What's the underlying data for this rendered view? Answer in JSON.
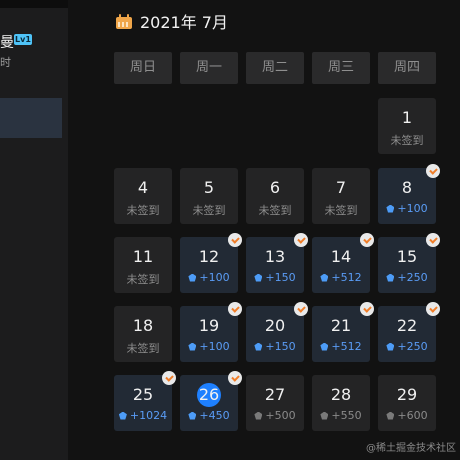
{
  "sidebar": {
    "user_name": "曼",
    "level": "Lv1",
    "user_sub": "时"
  },
  "calendar": {
    "month_title": "2021年 7月",
    "weekdays": [
      "周日",
      "周一",
      "周二",
      "周三",
      "周四"
    ],
    "unsigned_label": "未签到",
    "days": [
      {
        "day": "1",
        "status": "未签到"
      },
      {
        "day": "4",
        "status": "未签到"
      },
      {
        "day": "5",
        "status": "未签到"
      },
      {
        "day": "6",
        "status": "未签到"
      },
      {
        "day": "7",
        "status": "未签到"
      },
      {
        "day": "8",
        "reward": "+100",
        "signed": true
      },
      {
        "day": "11",
        "status": "未签到"
      },
      {
        "day": "12",
        "reward": "+100",
        "signed": true
      },
      {
        "day": "13",
        "reward": "+150",
        "signed": true
      },
      {
        "day": "14",
        "reward": "+512",
        "signed": true
      },
      {
        "day": "15",
        "reward": "+250",
        "signed": true
      },
      {
        "day": "18",
        "status": "未签到"
      },
      {
        "day": "19",
        "reward": "+100",
        "signed": true
      },
      {
        "day": "20",
        "reward": "+150",
        "signed": true
      },
      {
        "day": "21",
        "reward": "+512",
        "signed": true
      },
      {
        "day": "22",
        "reward": "+250",
        "signed": true
      },
      {
        "day": "25",
        "reward": "+1024",
        "signed": true
      },
      {
        "day": "26",
        "reward": "+450",
        "signed": true,
        "today": true
      },
      {
        "day": "27",
        "reward": "+500",
        "future": true
      },
      {
        "day": "28",
        "reward": "+550",
        "future": true
      },
      {
        "day": "29",
        "reward": "+600",
        "future": true
      }
    ]
  },
  "watermark": "@稀土掘金技术社区",
  "colors": {
    "accent": "#1e80ff",
    "ore": "#4d9cf7",
    "check": "#f07e2a",
    "calendar_icon": "#f0a64a"
  }
}
